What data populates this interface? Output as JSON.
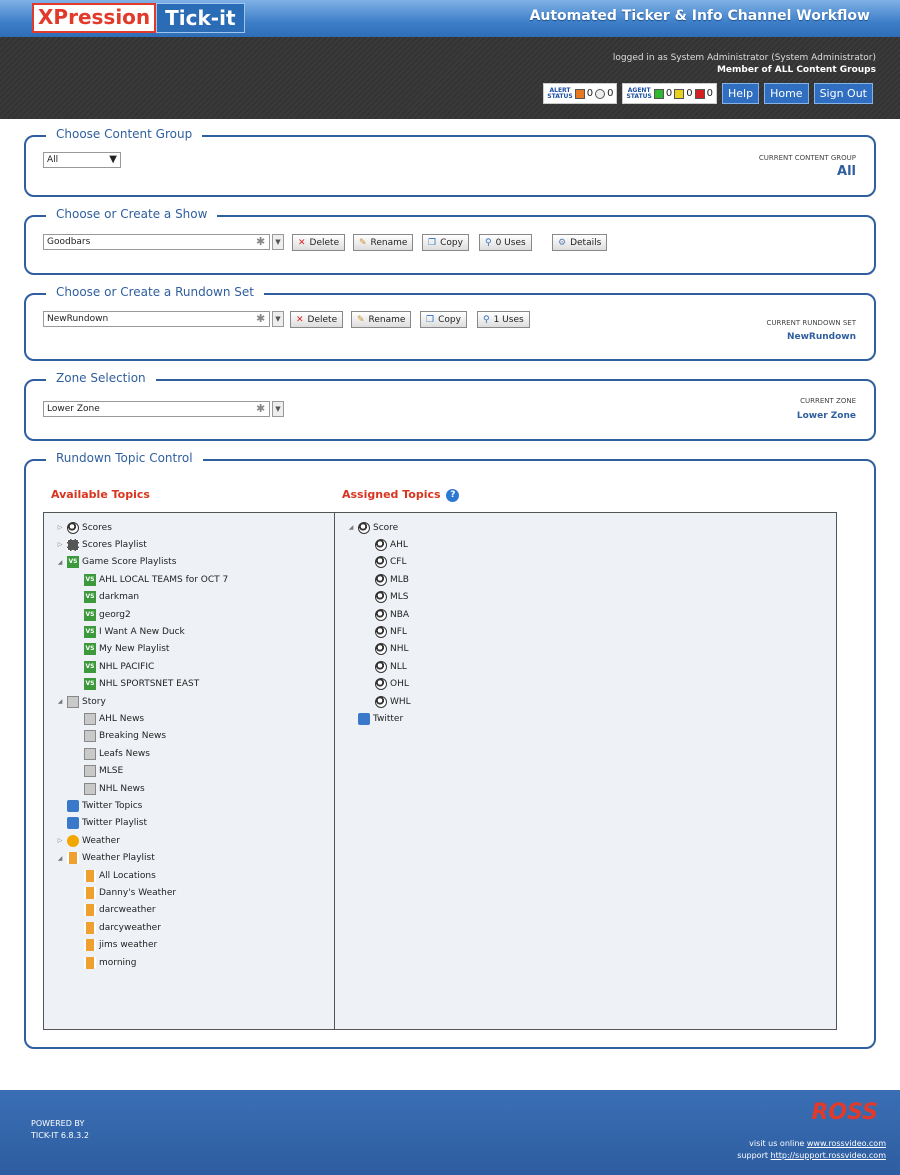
{
  "header": {
    "logo_part1": "XPression",
    "logo_part2": "Tick-it",
    "app_title": "Automated Ticker & Info Channel Workflow",
    "logged_in_text": "logged in as System Administrator (System Administrator)",
    "member_text": "Member of ALL Content Groups",
    "alert_label": "ALERT STATUS",
    "alert_count1": "0",
    "alert_count2": "0",
    "agent_label": "AGENT STATUS",
    "agent_green": "0",
    "agent_yellow": "0",
    "agent_red": "0",
    "help": "Help",
    "home": "Home",
    "signout": "Sign Out"
  },
  "content_group": {
    "legend": "Choose Content Group",
    "selected": "All",
    "current_label": "CURRENT CONTENT GROUP",
    "current_value": "All"
  },
  "show": {
    "legend": "Choose or Create a Show",
    "selected": "Goodbars",
    "delete": "Delete",
    "rename": "Rename",
    "copy": "Copy",
    "uses": "0 Uses",
    "details": "Details"
  },
  "rundown": {
    "legend": "Choose or Create a Rundown Set",
    "selected": "NewRundown",
    "delete": "Delete",
    "rename": "Rename",
    "copy": "Copy",
    "uses": "1 Uses",
    "current_label": "CURRENT RUNDOWN SET",
    "current_value": "NewRundown"
  },
  "zone": {
    "legend": "Zone Selection",
    "selected": "Lower Zone",
    "current_label": "CURRENT ZONE",
    "current_value": "Lower Zone"
  },
  "topics": {
    "legend": "Rundown Topic Control",
    "available_title": "Available Topics",
    "assigned_title": "Assigned Topics",
    "available": [
      {
        "label": "Scores",
        "icon": "ball",
        "twisty": "closed",
        "level": 0
      },
      {
        "label": "Scores Playlist",
        "icon": "playlist",
        "twisty": "closed",
        "level": 0
      },
      {
        "label": "Game Score Playlists",
        "icon": "vs",
        "twisty": "open",
        "level": 0
      },
      {
        "label": "AHL LOCAL TEAMS for OCT 7",
        "icon": "vs",
        "twisty": "",
        "level": 1
      },
      {
        "label": "darkman",
        "icon": "vs",
        "twisty": "",
        "level": 1
      },
      {
        "label": "georg2",
        "icon": "vs",
        "twisty": "",
        "level": 1
      },
      {
        "label": "I Want A New Duck",
        "icon": "vs",
        "twisty": "",
        "level": 1
      },
      {
        "label": "My New Playlist",
        "icon": "vs",
        "twisty": "",
        "level": 1
      },
      {
        "label": "NHL PACIFIC",
        "icon": "vs",
        "twisty": "",
        "level": 1
      },
      {
        "label": "NHL SPORTSNET EAST",
        "icon": "vs",
        "twisty": "",
        "level": 1
      },
      {
        "label": "Story",
        "icon": "story",
        "twisty": "open",
        "level": 0
      },
      {
        "label": "AHL News",
        "icon": "story",
        "twisty": "",
        "level": 1
      },
      {
        "label": "Breaking News",
        "icon": "story",
        "twisty": "",
        "level": 1
      },
      {
        "label": "Leafs News",
        "icon": "story",
        "twisty": "",
        "level": 1
      },
      {
        "label": "MLSE",
        "icon": "story",
        "twisty": "",
        "level": 1
      },
      {
        "label": "NHL News",
        "icon": "story",
        "twisty": "",
        "level": 1
      },
      {
        "label": "Twitter Topics",
        "icon": "twitter",
        "twisty": "",
        "level": 0
      },
      {
        "label": "Twitter Playlist",
        "icon": "twitter",
        "twisty": "",
        "level": 0
      },
      {
        "label": "Weather",
        "icon": "sun",
        "twisty": "closed",
        "level": 0
      },
      {
        "label": "Weather Playlist",
        "icon": "film",
        "twisty": "open",
        "level": 0
      },
      {
        "label": "All Locations",
        "icon": "film",
        "twisty": "",
        "level": 1
      },
      {
        "label": "Danny's Weather",
        "icon": "film",
        "twisty": "",
        "level": 1
      },
      {
        "label": "darcweather",
        "icon": "film",
        "twisty": "",
        "level": 1
      },
      {
        "label": "darcyweather",
        "icon": "film",
        "twisty": "",
        "level": 1
      },
      {
        "label": "jims weather",
        "icon": "film",
        "twisty": "",
        "level": 1
      },
      {
        "label": "morning",
        "icon": "film",
        "twisty": "",
        "level": 1
      }
    ],
    "assigned": [
      {
        "label": "Score",
        "icon": "ball",
        "twisty": "open",
        "level": 0
      },
      {
        "label": "AHL",
        "icon": "ball",
        "twisty": "",
        "level": 1
      },
      {
        "label": "CFL",
        "icon": "ball",
        "twisty": "",
        "level": 1
      },
      {
        "label": "MLB",
        "icon": "ball",
        "twisty": "",
        "level": 1
      },
      {
        "label": "MLS",
        "icon": "ball",
        "twisty": "",
        "level": 1
      },
      {
        "label": "NBA",
        "icon": "ball",
        "twisty": "",
        "level": 1
      },
      {
        "label": "NFL",
        "icon": "ball",
        "twisty": "",
        "level": 1
      },
      {
        "label": "NHL",
        "icon": "ball",
        "twisty": "",
        "level": 1
      },
      {
        "label": "NLL",
        "icon": "ball",
        "twisty": "",
        "level": 1
      },
      {
        "label": "OHL",
        "icon": "ball",
        "twisty": "",
        "level": 1
      },
      {
        "label": "WHL",
        "icon": "ball",
        "twisty": "",
        "level": 1
      },
      {
        "label": "Twitter",
        "icon": "twitter",
        "twisty": "",
        "level": 0
      }
    ]
  },
  "footer": {
    "powered_by": "POWERED BY",
    "version": "TICK-IT 6.8.3.2",
    "brand": "ROSS",
    "visit_label": "visit us online",
    "visit_link": "www.rossvideo.com",
    "support_label": "support",
    "support_link": "http://support.rossvideo.com"
  }
}
